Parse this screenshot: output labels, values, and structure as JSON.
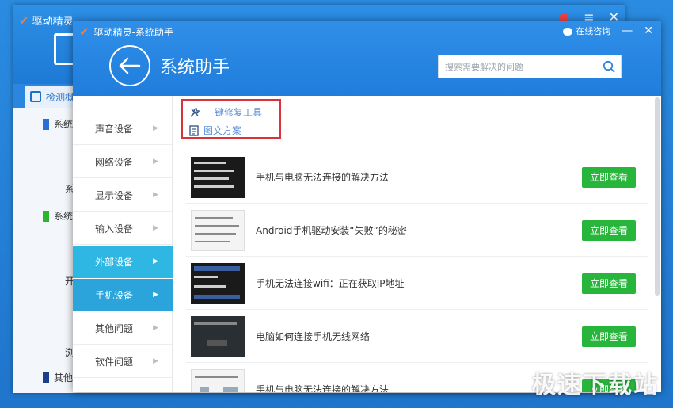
{
  "bg_window": {
    "app_name": "驱动精灵",
    "tab_label": "检测概",
    "items": [
      {
        "label": "系统",
        "color": "#2a6fd6"
      },
      {
        "label": "系统",
        "color": "#2ab52a"
      },
      {
        "label": "其他",
        "color": "#1a3f8a"
      }
    ],
    "fragments": [
      "系",
      "开",
      "浏"
    ]
  },
  "dialog": {
    "window_title": "驱动精灵-系统助手",
    "online_consult": "在线咨询",
    "heading": "系统助手",
    "search_placeholder": "搜索需要解决的问题"
  },
  "sidebar": {
    "items": [
      {
        "label": "声音设备",
        "state": "normal"
      },
      {
        "label": "网络设备",
        "state": "normal"
      },
      {
        "label": "显示设备",
        "state": "normal"
      },
      {
        "label": "输入设备",
        "state": "normal"
      },
      {
        "label": "外部设备",
        "state": "active"
      },
      {
        "label": "手机设备",
        "state": "selected"
      },
      {
        "label": "其他问题",
        "state": "normal"
      },
      {
        "label": "软件问题",
        "state": "normal"
      }
    ]
  },
  "tools": {
    "repair": "一键修复工具",
    "guide": "图文方案"
  },
  "articles": [
    {
      "title": "手机与电脑无法连接的解决方法",
      "button": "立即查看",
      "thumb": "dark"
    },
    {
      "title": "Android手机驱动安装“失败”的秘密",
      "button": "立即查看",
      "thumb": "light"
    },
    {
      "title": "手机无法连接wifi：正在获取IP地址",
      "button": "立即查看",
      "thumb": "dark"
    },
    {
      "title": "电脑如何连接手机无线网络",
      "button": "立即查看",
      "thumb": "dark"
    },
    {
      "title": "手机与电脑无法连接的解决方法",
      "button": "立即查看",
      "thumb": "light"
    }
  ],
  "watermark": "极速下载站",
  "colors": {
    "header_blue": "#207ddc",
    "active_cyan": "#2fb7e4",
    "button_green": "#27b53b",
    "highlight_red": "#d9333a",
    "link_blue": "#5a8fd8"
  }
}
